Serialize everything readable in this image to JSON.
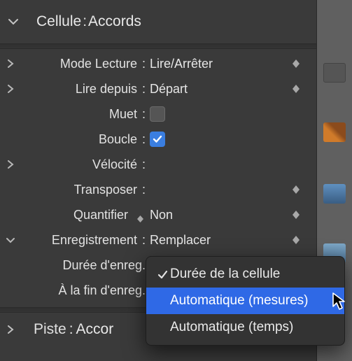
{
  "header": {
    "section_label": "Cellule",
    "section_value": "Accords"
  },
  "rows": {
    "play_mode": {
      "label": "Mode Lecture",
      "value": "Lire/Arrêter"
    },
    "play_from": {
      "label": "Lire depuis",
      "value": "Départ"
    },
    "mute": {
      "label": "Muet",
      "checked": false
    },
    "loop": {
      "label": "Boucle",
      "checked": true
    },
    "velocity": {
      "label": "Vélocité"
    },
    "transpose": {
      "label": "Transposer"
    },
    "quantize": {
      "label": "Quantifier",
      "value": "Non"
    },
    "record": {
      "label": "Enregistrement",
      "value": "Remplacer"
    },
    "rec_len": {
      "label": "Durée d'enreg."
    },
    "rec_end": {
      "label": "À la fin d'enreg."
    }
  },
  "menu": {
    "items": [
      {
        "label": "Durée de la cellule",
        "checked": true
      },
      {
        "label": "Automatique (mesures)",
        "selected": true
      },
      {
        "label": "Automatique (temps)"
      }
    ]
  },
  "track": {
    "label": "Piste",
    "value": "Accor"
  },
  "icons": {
    "chev_down": "chevron-down-icon",
    "chev_right": "chevron-right-icon",
    "checkmark": "checkmark-icon",
    "updown": "up-down-arrows-icon"
  }
}
